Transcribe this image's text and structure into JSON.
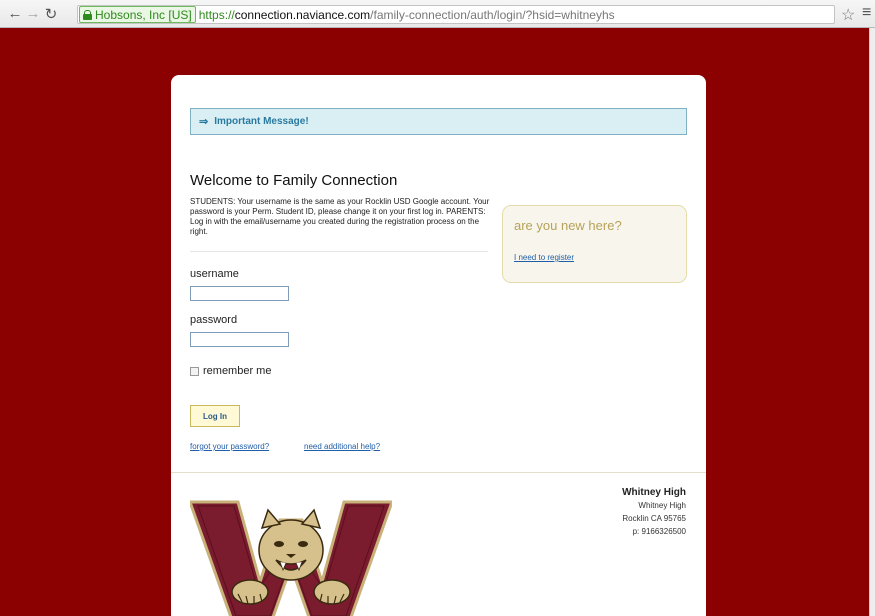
{
  "browser": {
    "ev_label": "Hobsons, Inc [US]",
    "url_scheme": "https://",
    "url_host": "connection.naviance.com",
    "url_path": "/family-connection/auth/login/?hsid=whitneyhs"
  },
  "message": {
    "label": "Important Message!"
  },
  "welcome": {
    "title": "Welcome to Family Connection",
    "intro": "STUDENTS: Your username is the same as your Rocklin USD Google account. Your password is your Perm. Student ID, please change it on your first log in. PARENTS: Log in with the email/username you created during the registration process on the right."
  },
  "login_form": {
    "username_label": "username",
    "username_value": "",
    "password_label": "password",
    "password_value": "",
    "remember_label": "remember me",
    "remember_checked": false,
    "login_button": "Log In",
    "forgot_link": "forgot your password?",
    "help_link": "need additional help?"
  },
  "register_box": {
    "title": "are you new here?",
    "link": "I need to register"
  },
  "school": {
    "name": "Whitney High",
    "line1": "Whitney High",
    "line2": "Rocklin CA 95765",
    "line3": "p: 9166326500"
  },
  "colors": {
    "page_background": "#8b0000",
    "message_background": "#d9eff4",
    "register_title": "#b7a25a",
    "link": "#1f5ea8"
  }
}
